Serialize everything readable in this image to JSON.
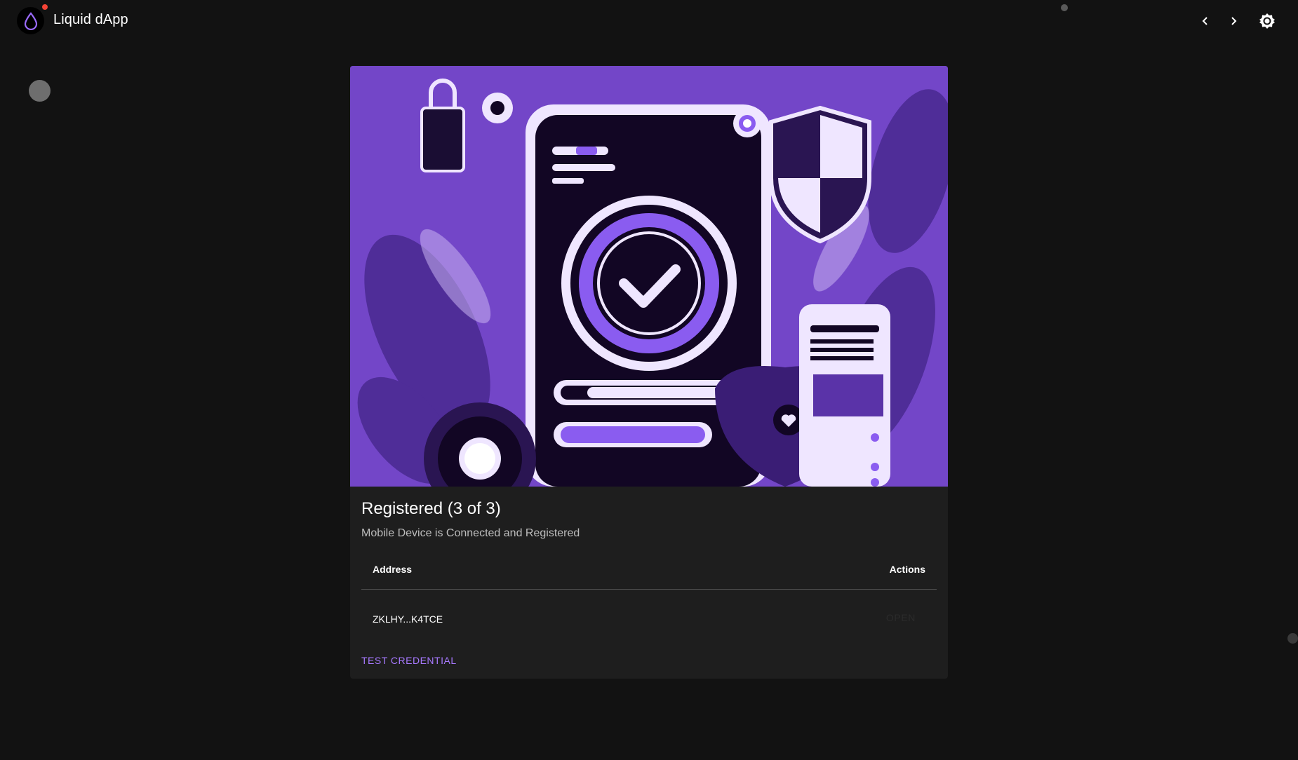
{
  "app": {
    "title": "Liquid dApp",
    "logo_icon": "droplet-icon"
  },
  "toolbar": {
    "prev_icon": "chevron-left-icon",
    "next_icon": "chevron-right-icon",
    "theme_icon": "brightness-icon"
  },
  "card": {
    "image_icon": "verified-device-illustration",
    "title": "Registered (3 of 3)",
    "subtitle": "Mobile Device is Connected and Registered",
    "table": {
      "headers": {
        "address": "Address",
        "actions": "Actions"
      },
      "rows": [
        {
          "address": "ZKLHY...K4TCE",
          "action": "OPEN"
        }
      ]
    },
    "action_label": "TEST CREDENTIAL"
  },
  "colors": {
    "background": "#121212",
    "card": "#1e1e1e",
    "accent": "#a779ff",
    "hero_purple": "#7346c8",
    "badge": "#f44336"
  }
}
